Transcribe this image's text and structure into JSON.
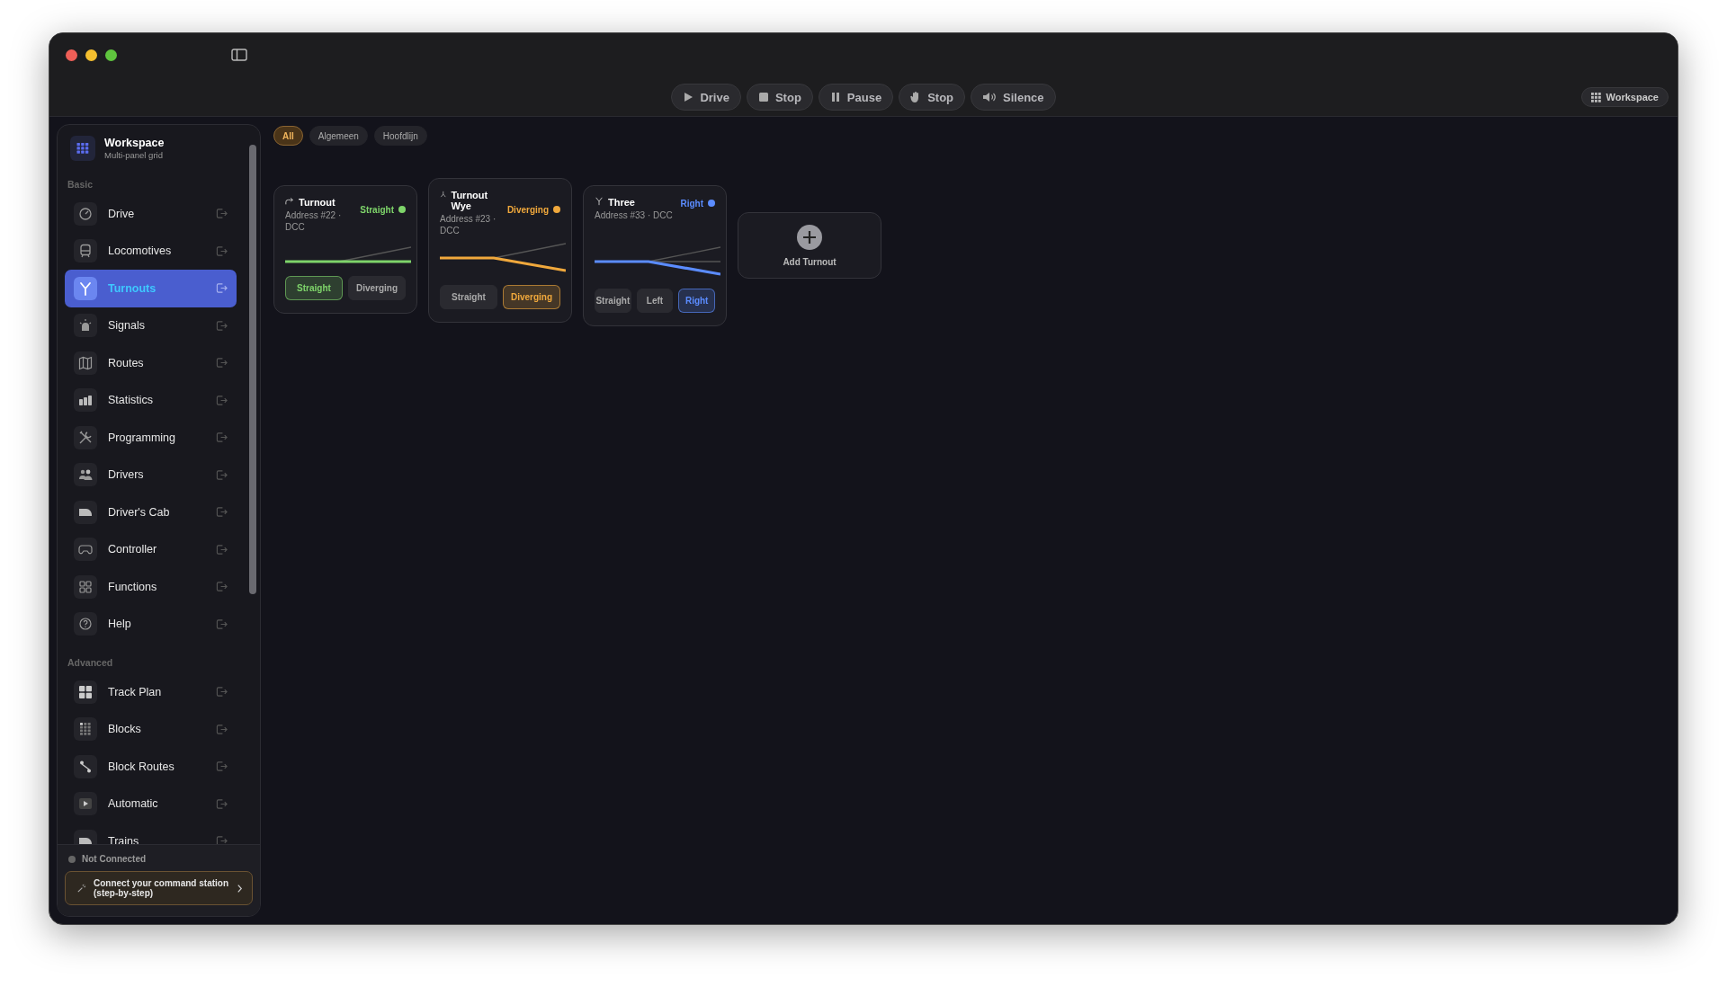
{
  "toolbar": [
    {
      "kind": "play",
      "label": "Drive"
    },
    {
      "kind": "square",
      "label": "Stop"
    },
    {
      "kind": "pause",
      "label": "Pause"
    },
    {
      "kind": "hand",
      "label": "Stop"
    },
    {
      "kind": "speaker",
      "label": "Silence"
    }
  ],
  "workspace_button": "Workspace",
  "sidebar": {
    "header": {
      "title": "Workspace",
      "subtitle": "Multi-panel grid"
    },
    "sections": [
      {
        "title": "Basic",
        "items": [
          {
            "kind": "gauge",
            "label": "Drive",
            "selected": false
          },
          {
            "kind": "train",
            "label": "Locomotives",
            "selected": false
          },
          {
            "kind": "fork",
            "label": "Turnouts",
            "selected": true
          },
          {
            "kind": "beacon",
            "label": "Signals",
            "selected": false
          },
          {
            "kind": "map",
            "label": "Routes",
            "selected": false
          },
          {
            "kind": "bars",
            "label": "Statistics",
            "selected": false
          },
          {
            "kind": "tools",
            "label": "Programming",
            "selected": false
          },
          {
            "kind": "people",
            "label": "Drivers",
            "selected": false
          },
          {
            "kind": "cab",
            "label": "Driver's Cab",
            "selected": false
          },
          {
            "kind": "gamepad",
            "label": "Controller",
            "selected": false
          },
          {
            "kind": "grid4",
            "label": "Functions",
            "selected": false
          },
          {
            "kind": "help",
            "label": "Help",
            "selected": false
          }
        ]
      },
      {
        "title": "Advanced",
        "items": [
          {
            "kind": "tiles",
            "label": "Track Plan",
            "selected": false
          },
          {
            "kind": "dots",
            "label": "Blocks",
            "selected": false
          },
          {
            "kind": "route",
            "label": "Block Routes",
            "selected": false
          },
          {
            "kind": "playbox",
            "label": "Automatic",
            "selected": false
          },
          {
            "kind": "cab",
            "label": "Trains",
            "selected": false
          }
        ]
      }
    ],
    "status": {
      "connected": false,
      "label": "Not Connected"
    },
    "connect_button": "Connect your command station (step-by-step)"
  },
  "filters": [
    {
      "label": "All",
      "selected": true
    },
    {
      "label": "Algemeen",
      "selected": false
    },
    {
      "label": "Hoofdlijn",
      "selected": false
    }
  ],
  "turnouts": [
    {
      "kind": "turnout",
      "title": "Turnout",
      "address": "Address #22 · DCC",
      "state": "Straight",
      "color": "#7ed46a",
      "buttons": [
        {
          "label": "Straight",
          "selected": true
        },
        {
          "label": "Diverging",
          "selected": false
        }
      ]
    },
    {
      "kind": "wye",
      "title": "Turnout Wye",
      "address": "Address #23 · DCC",
      "state": "Diverging",
      "color": "#f0a83c",
      "buttons": [
        {
          "label": "Straight",
          "selected": false
        },
        {
          "label": "Diverging",
          "selected": true
        }
      ]
    },
    {
      "kind": "three-way",
      "title": "Three",
      "address": "Address #33 · DCC",
      "state": "Right",
      "color": "#5b8cff",
      "buttons": [
        {
          "label": "Straight",
          "selected": false
        },
        {
          "label": "Left",
          "selected": false
        },
        {
          "label": "Right",
          "selected": true
        }
      ]
    }
  ],
  "add_button": "Add Turnout"
}
